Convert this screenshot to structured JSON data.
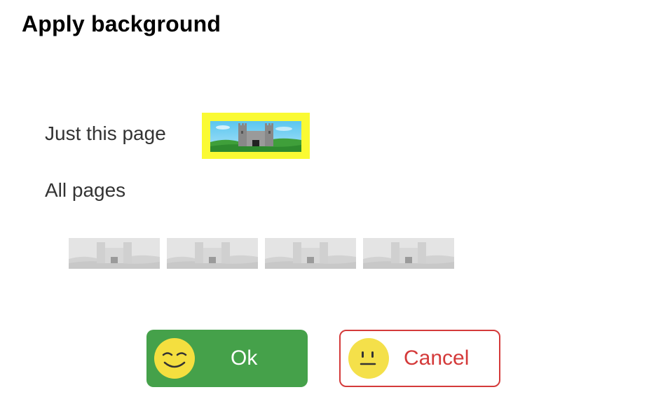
{
  "dialog": {
    "title": "Apply background"
  },
  "options": {
    "this_page_label": "Just this page",
    "all_pages_label": "All pages",
    "selected": "this_page"
  },
  "thumbnails": {
    "selected_border_color": "#fafa33",
    "all_pages_count": 4,
    "all_pages_state": "dimmed"
  },
  "buttons": {
    "ok_label": "Ok",
    "ok_icon": "smiling-face-icon",
    "ok_color": "#45a14a",
    "cancel_label": "Cancel",
    "cancel_icon": "neutral-face-icon",
    "cancel_color": "#d43a3a"
  }
}
